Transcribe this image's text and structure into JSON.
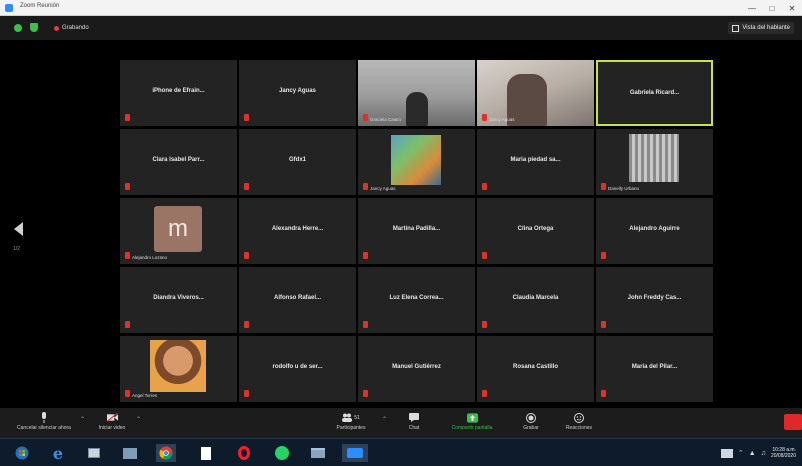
{
  "window": {
    "title": "Zoom Reunión"
  },
  "topbar": {
    "recording_label": "Grabando",
    "view_button_label": "Vista del hablante"
  },
  "grid": {
    "page_indicator": "1/2",
    "tiles": [
      {
        "name": "iPhone de Efrain...",
        "video_name": ""
      },
      {
        "name": "Jancy Aguas",
        "video_name": ""
      },
      {
        "name": "",
        "video_name": "Graciela Castro"
      },
      {
        "name": "",
        "video_name": "Jancy Aguas"
      },
      {
        "name": "Gabriela Ricard...",
        "video_name": ""
      },
      {
        "name": "Clara Isabel Parr...",
        "video_name": ""
      },
      {
        "name": "Gfdx1",
        "video_name": ""
      },
      {
        "name": "",
        "video_name": "Jancy Aguas"
      },
      {
        "name": "Maria piedad sa...",
        "video_name": ""
      },
      {
        "name": "",
        "video_name": "Danelly Urbano"
      },
      {
        "name": "",
        "video_name": "Alejandro Lozano",
        "avatar_letter": "m"
      },
      {
        "name": "Alexandra Herre...",
        "video_name": ""
      },
      {
        "name": "Martina Padilla...",
        "video_name": ""
      },
      {
        "name": "Clina Ortega",
        "video_name": ""
      },
      {
        "name": "Alejandro Aguirre",
        "video_name": ""
      },
      {
        "name": "Diandra Viveros...",
        "video_name": ""
      },
      {
        "name": "Alfonso Rafael...",
        "video_name": ""
      },
      {
        "name": "Luz Elena Correa...",
        "video_name": ""
      },
      {
        "name": "Claudia Marcela",
        "video_name": ""
      },
      {
        "name": "John Freddy Cas...",
        "video_name": ""
      },
      {
        "name": "",
        "video_name": "Angel Torres"
      },
      {
        "name": "rodolfo u de ser...",
        "video_name": ""
      },
      {
        "name": "Manuel Gutiérrez",
        "video_name": ""
      },
      {
        "name": "Rosana Castillo",
        "video_name": ""
      },
      {
        "name": "Maria del Pilar...",
        "video_name": ""
      }
    ]
  },
  "toolbar": {
    "unmute_label": "Cancelar silenciar ahora",
    "video_label": "Iniciar video",
    "participants_label": "Participantes",
    "participants_count": "51",
    "chat_label": "Chat",
    "share_label": "Compartir pantalla",
    "record_label": "Grabar",
    "reactions_label": "Reacciones"
  },
  "taskbar": {
    "apps": [
      "start-icon",
      "edge-icon",
      "explorer-icon",
      "file-manager-icon",
      "chrome-icon",
      "document-icon",
      "opera-icon",
      "whatsapp-icon",
      "folder-icon",
      "zoom-icon"
    ],
    "time": "10:28 a.m.",
    "date": "20/08/2020"
  },
  "colors": {
    "active_speaker": "#c9e14a",
    "mic_muted": "#d9342b",
    "share_green": "#3cbf4a",
    "end_red": "#e02828"
  }
}
